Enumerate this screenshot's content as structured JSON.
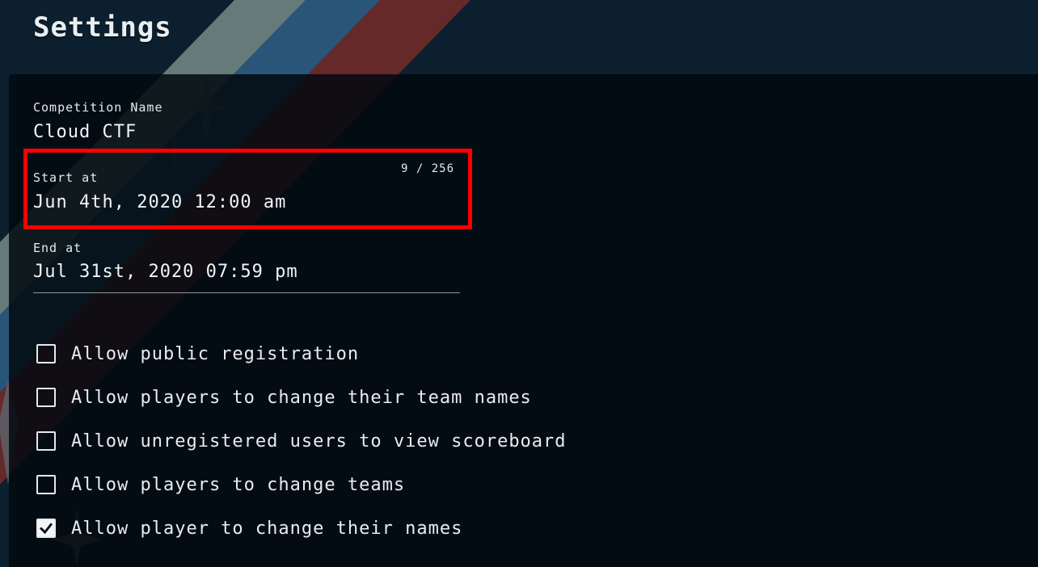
{
  "page": {
    "title": "Settings"
  },
  "colors": {
    "background": "#0b1f2e",
    "panel": "#02090f",
    "stripe_gray": "#6b7f7e",
    "stripe_blue": "#2b5a7c",
    "stripe_red": "#6a2a2a",
    "highlight": "#ff0000",
    "text": "#e9ecef"
  },
  "form": {
    "competition_name": {
      "label": "Competition Name",
      "value": "Cloud CTF"
    },
    "start_at": {
      "label": "Start at",
      "value": "Jun 4th, 2020 12:00 am",
      "counter": "9 / 256"
    },
    "end_at": {
      "label": "End at",
      "value": "Jul 31st, 2020 07:59 pm"
    },
    "options": [
      {
        "label": "Allow public registration",
        "checked": false
      },
      {
        "label": "Allow players to change their team names",
        "checked": false
      },
      {
        "label": "Allow unregistered users to view scoreboard",
        "checked": false
      },
      {
        "label": "Allow players to change teams",
        "checked": false
      },
      {
        "label": "Allow player to change their names",
        "checked": true
      }
    ]
  },
  "icons": {
    "checked": "check-icon",
    "decor": "sparkle-icon"
  }
}
